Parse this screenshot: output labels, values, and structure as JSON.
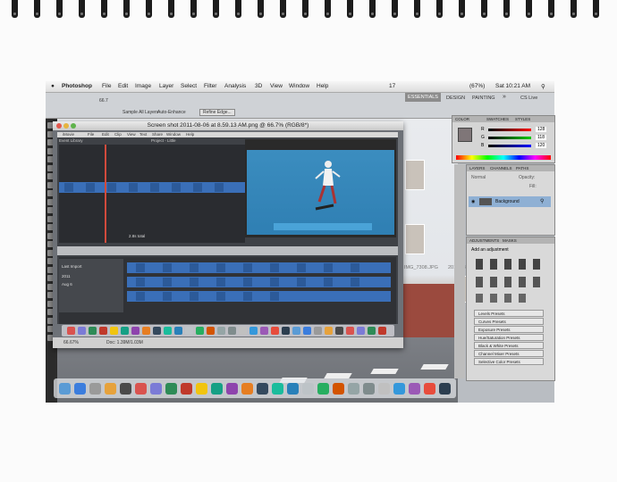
{
  "menubar": {
    "apple": "",
    "app_name": "Photoshop",
    "items": [
      "File",
      "Edit",
      "Image",
      "Layer",
      "Select",
      "Filter",
      "Analysis",
      "3D",
      "View",
      "Window",
      "Help"
    ],
    "status": {
      "ps_badge": "17",
      "battery": "(67%)",
      "clock": "Sat 10:21 AM"
    }
  },
  "workspace": {
    "essentials": "ESSENTIALS",
    "design": "DESIGN",
    "painting": "PAINTING",
    "chevron": "»",
    "cslive": "CS Live"
  },
  "options_bar": {
    "zoom": "66.7",
    "sample_all_layers": "Sample All Layers",
    "auto_enhance": "Auto-Enhance",
    "refine_edge": "Refine Edge..."
  },
  "document": {
    "title": "Screen shot 2011-08-06 at 8.59.13 AM.png @ 66.7% (RGB/8*)",
    "zoom_status": "66.67%",
    "doc_size": "Doc: 1.39M/1.03M",
    "imovie": {
      "menu": [
        "iMovie",
        "File",
        "Edit",
        "Clip",
        "View",
        "Text",
        "Share",
        "Window",
        "Help"
      ],
      "event_library": "Event Library",
      "project_list": [
        "Last Import",
        "2011",
        "Aug 6"
      ],
      "project_title": "Project - Little",
      "timecode": "2.8s total"
    }
  },
  "desktop_files": [
    "IMG_7308.JPG",
    "2011-08-0"
  ],
  "panels": {
    "color": {
      "tabs": [
        "COLOR",
        "SWATCHES",
        "STYLES"
      ],
      "labels": [
        "R",
        "G",
        "B"
      ],
      "values": [
        "128",
        "118",
        "120"
      ]
    },
    "layers": {
      "tabs": [
        "LAYERS",
        "CHANNELS",
        "PATHS"
      ],
      "mode": "Normal",
      "opacity_label": "Opacity:",
      "fill_label": "Fill:",
      "layer_name": "Background"
    },
    "adjustments": {
      "tabs": [
        "ADJUSTMENTS",
        "MASKS"
      ],
      "heading": "Add an adjustment",
      "presets": [
        "Levels Presets",
        "Curves Presets",
        "Exposure Presets",
        "Hue/Saturation Presets",
        "Black & White Presets",
        "Channel Mixer Presets",
        "Selective Color Presets"
      ]
    }
  },
  "colors": {
    "menubar": "#e8e8e8",
    "panel": "#d5d5d5",
    "bluescreen": "#2f7fb3",
    "brick": "#9b4a3e"
  }
}
